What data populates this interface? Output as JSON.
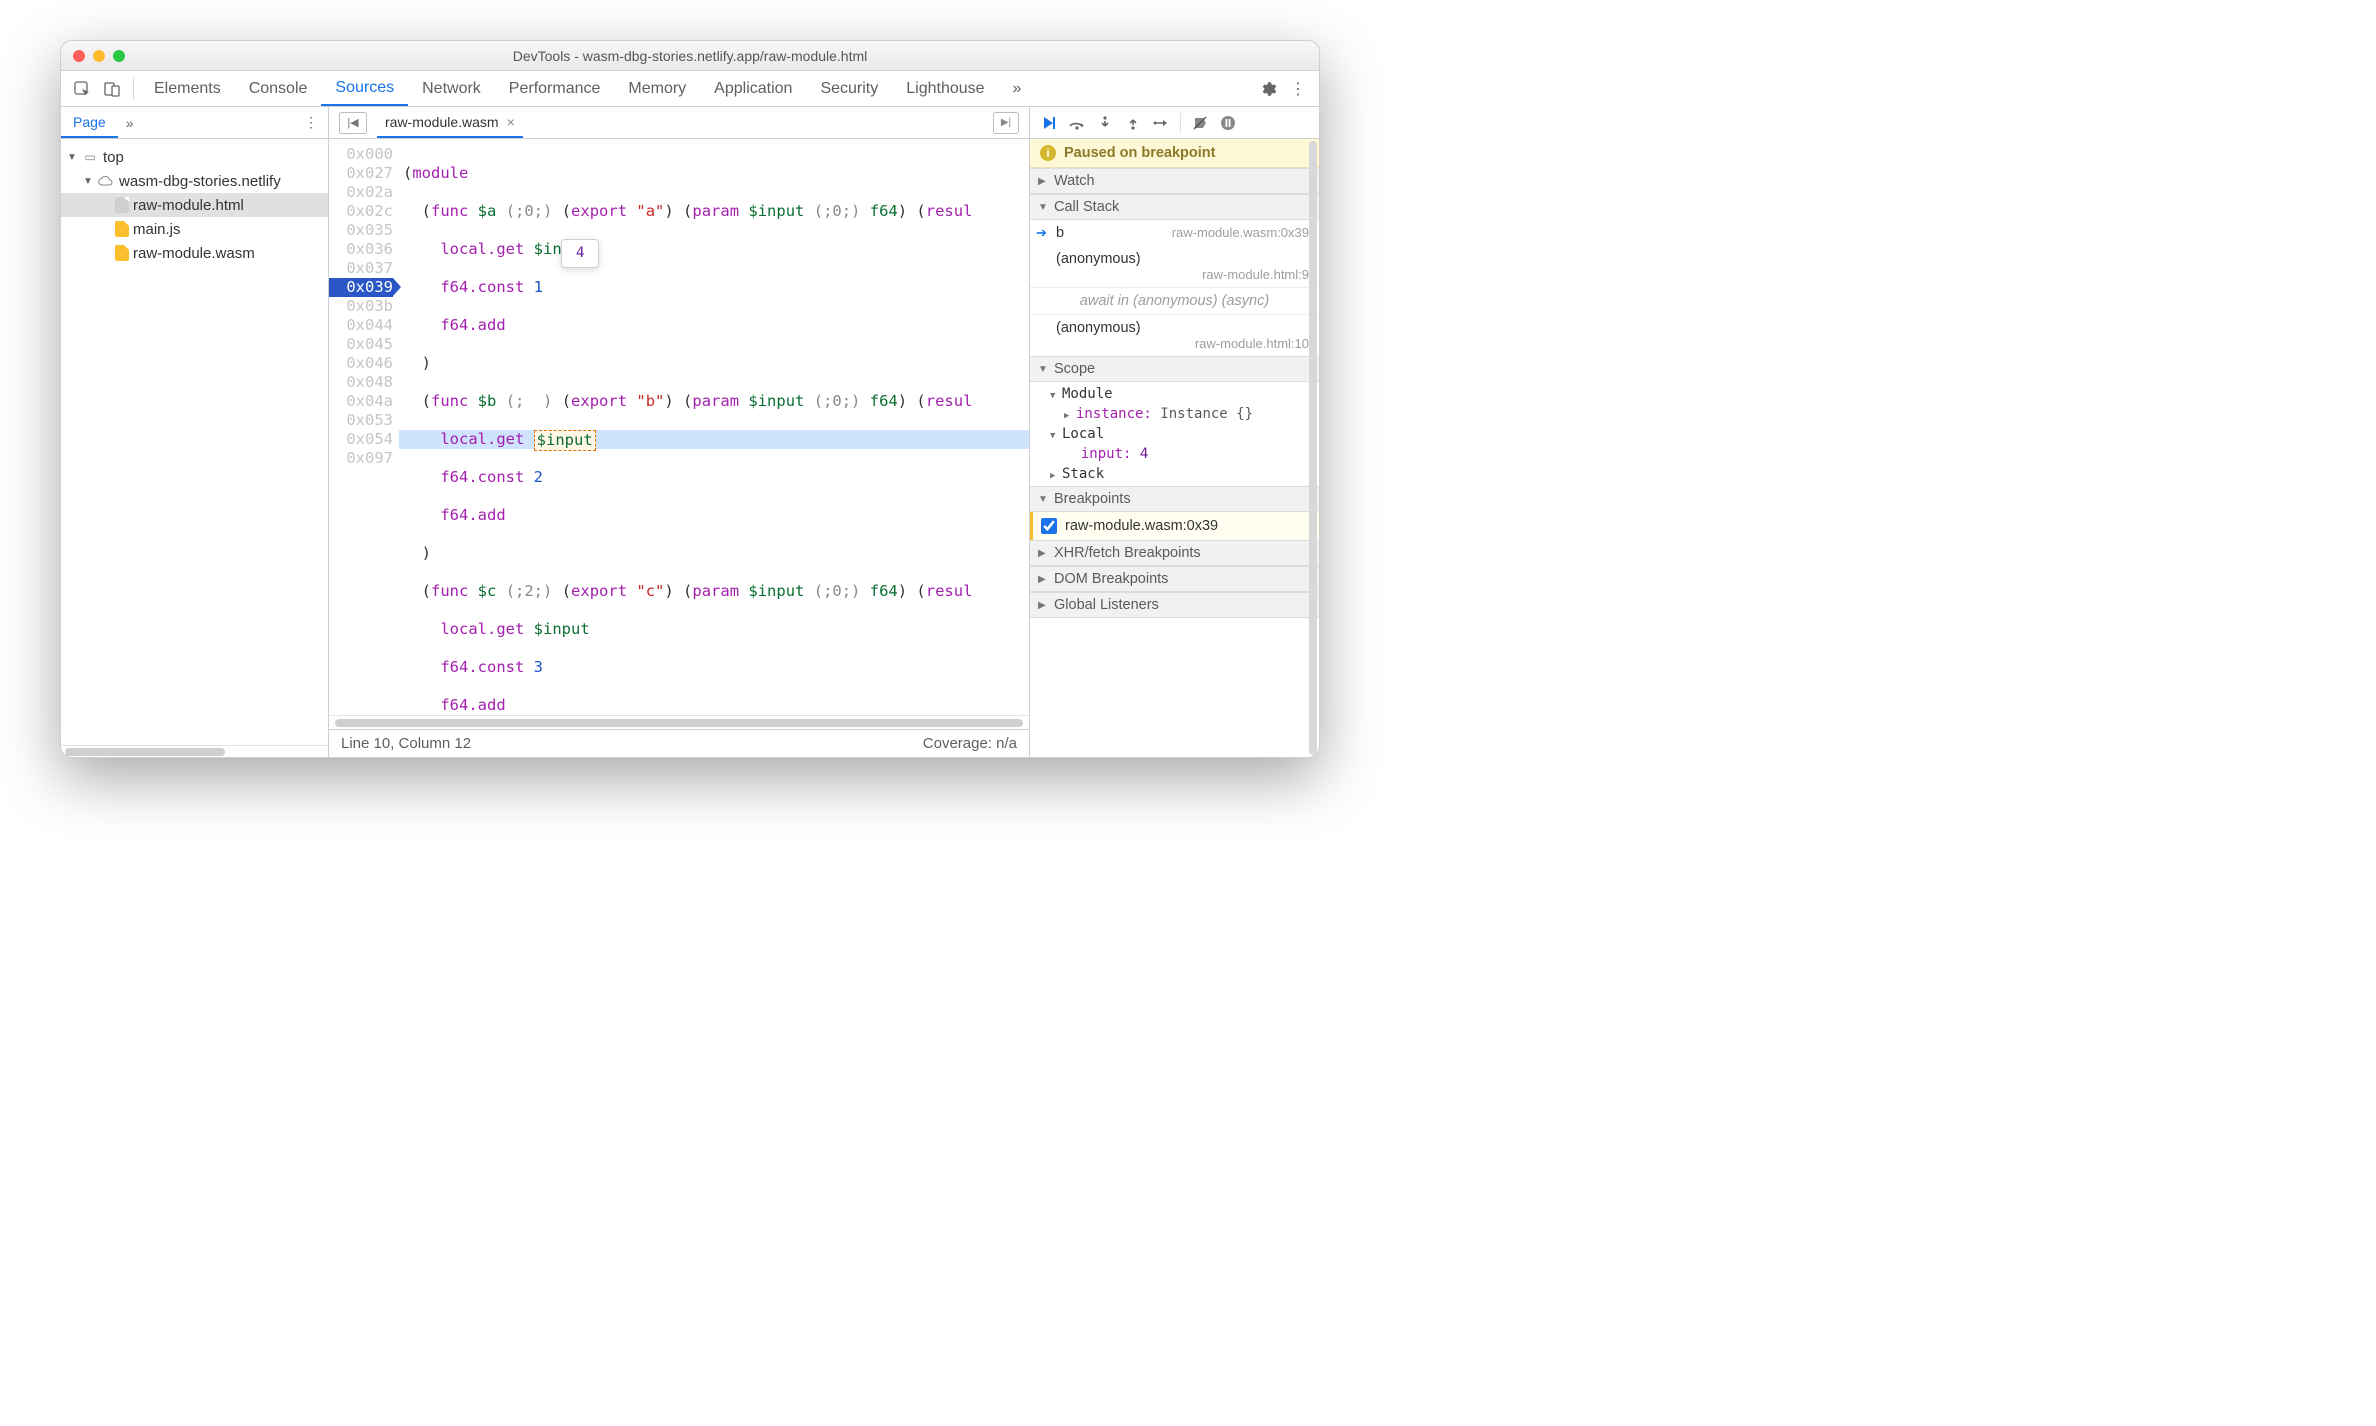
{
  "window_title": "DevTools - wasm-dbg-stories.netlify.app/raw-module.html",
  "tabs": {
    "items": [
      "Elements",
      "Console",
      "Sources",
      "Network",
      "Performance",
      "Memory",
      "Application",
      "Security",
      "Lighthouse"
    ],
    "active": "Sources",
    "overflow": "»"
  },
  "left": {
    "page_tab": "Page",
    "chev": "»",
    "tree": {
      "top": "top",
      "domain": "wasm-dbg-stories.netlify",
      "files": [
        {
          "name": "raw-module.html",
          "kind": "doc",
          "sel": true
        },
        {
          "name": "main.js",
          "kind": "docy"
        },
        {
          "name": "raw-module.wasm",
          "kind": "docy"
        }
      ]
    }
  },
  "center": {
    "filename": "raw-module.wasm",
    "close": "×",
    "tooltip_value": "4",
    "gutter": [
      "0x000",
      "0x027",
      "0x02a",
      "0x02c",
      "0x035",
      "0x036",
      "0x037",
      "0x039",
      "0x03b",
      "0x044",
      "0x045",
      "0x046",
      "0x048",
      "0x04a",
      "0x053",
      "0x054",
      "0x097"
    ],
    "status_left": "Line 10, Column 12",
    "status_right": "Coverage: n/a"
  },
  "right": {
    "paused_msg": "Paused on breakpoint",
    "sections": {
      "watch": "Watch",
      "callstack": "Call Stack",
      "scope": "Scope",
      "breakpoints": "Breakpoints",
      "xhr": "XHR/fetch Breakpoints",
      "dom": "DOM Breakpoints",
      "listeners": "Global Listeners"
    },
    "callstack": [
      {
        "name": "b",
        "loc": "raw-module.wasm:0x39",
        "current": true
      },
      {
        "name": "(anonymous)",
        "loc": "raw-module.html:9"
      },
      {
        "async": "await in (anonymous) (async)"
      },
      {
        "name": "(anonymous)",
        "loc": "raw-module.html:10"
      }
    ],
    "scope": {
      "module_label": "Module",
      "instance_label": "instance:",
      "instance_value": "Instance {}",
      "local_label": "Local",
      "input_label": "input:",
      "input_value": "4",
      "stack_label": "Stack"
    },
    "breakpoint_item": "raw-module.wasm:0x39"
  }
}
